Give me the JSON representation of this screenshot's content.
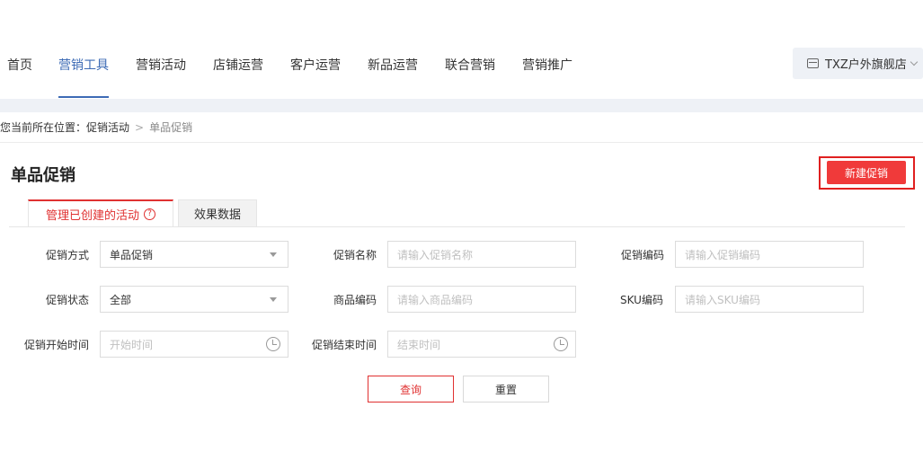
{
  "nav": {
    "items": [
      {
        "label": "首页"
      },
      {
        "label": "营销工具",
        "active": true
      },
      {
        "label": "营销活动"
      },
      {
        "label": "店铺运营"
      },
      {
        "label": "客户运营"
      },
      {
        "label": "新品运营"
      },
      {
        "label": "联合营销"
      },
      {
        "label": "营销推广"
      }
    ],
    "shop_name": "TXZ户外旗舰店",
    "accent_color": "#3d6bb5"
  },
  "breadcrumb": {
    "prefix": "您当前所在位置：",
    "parent": "促销活动",
    "current": "单品促销"
  },
  "page": {
    "title": "单品促销",
    "new_button": "新建促销",
    "brand_color": "#f03a3a"
  },
  "tabs": {
    "manage": "管理已创建的活动",
    "effect": "效果数据"
  },
  "form": {
    "promo_type": {
      "label": "促销方式",
      "value": "单品促销"
    },
    "promo_name": {
      "label": "促销名称",
      "placeholder": "请输入促销名称"
    },
    "promo_code": {
      "label": "促销编码",
      "placeholder": "请输入促销编码"
    },
    "promo_status": {
      "label": "促销状态",
      "value": "全部"
    },
    "product_code": {
      "label": "商品编码",
      "placeholder": "请输入商品编码"
    },
    "sku_code": {
      "label": "SKU编码",
      "placeholder": "请输入SKU编码"
    },
    "start_time": {
      "label": "促销开始时间",
      "placeholder": "开始时间"
    },
    "end_time": {
      "label": "促销结束时间",
      "placeholder": "结束时间"
    }
  },
  "actions": {
    "query": "查询",
    "reset": "重置"
  }
}
